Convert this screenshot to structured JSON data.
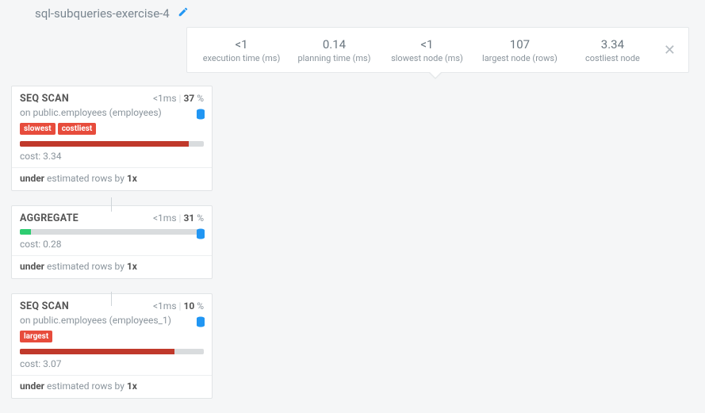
{
  "header": {
    "title": "sql-subqueries-exercise-4"
  },
  "stats": {
    "execution_time": {
      "value": "<1",
      "label": "execution time (ms)"
    },
    "planning_time": {
      "value": "0.14",
      "label": "planning time (ms)"
    },
    "slowest_node": {
      "value": "<1",
      "label": "slowest node (ms)"
    },
    "largest_node": {
      "value": "107",
      "label": "largest node (rows)"
    },
    "costliest_node": {
      "value": "3.34",
      "label": "costliest node"
    }
  },
  "nodes": [
    {
      "title": "SEQ SCAN",
      "time": "<1ms",
      "pct": "37",
      "pct_suffix": " %",
      "subtext_prefix": "on ",
      "subtext": "public.employees (employees)",
      "tags": [
        "slowest",
        "costliest"
      ],
      "bar_pct": 92,
      "bar_color": "red",
      "cost_label": "cost: ",
      "cost": "3.34",
      "est_prefix": "under",
      "est_mid": " estimated rows by ",
      "est_factor": "1x",
      "has_db_icon": true
    },
    {
      "title": "AGGREGATE",
      "time": "<1ms",
      "pct": "31",
      "pct_suffix": " %",
      "subtext_prefix": "",
      "subtext": "",
      "tags": [],
      "bar_pct": 6,
      "bar_color": "green",
      "cost_label": "cost: ",
      "cost": "0.28",
      "est_prefix": "under",
      "est_mid": " estimated rows by ",
      "est_factor": "1x",
      "has_db_icon": true
    },
    {
      "title": "SEQ SCAN",
      "time": "<1ms",
      "pct": "10",
      "pct_suffix": " %",
      "subtext_prefix": "on ",
      "subtext": "public.employees (employees_1)",
      "tags": [
        "largest"
      ],
      "bar_pct": 84,
      "bar_color": "red",
      "cost_label": "cost: ",
      "cost": "3.07",
      "est_prefix": "under",
      "est_mid": " estimated rows by ",
      "est_factor": "1x",
      "has_db_icon": true
    }
  ]
}
